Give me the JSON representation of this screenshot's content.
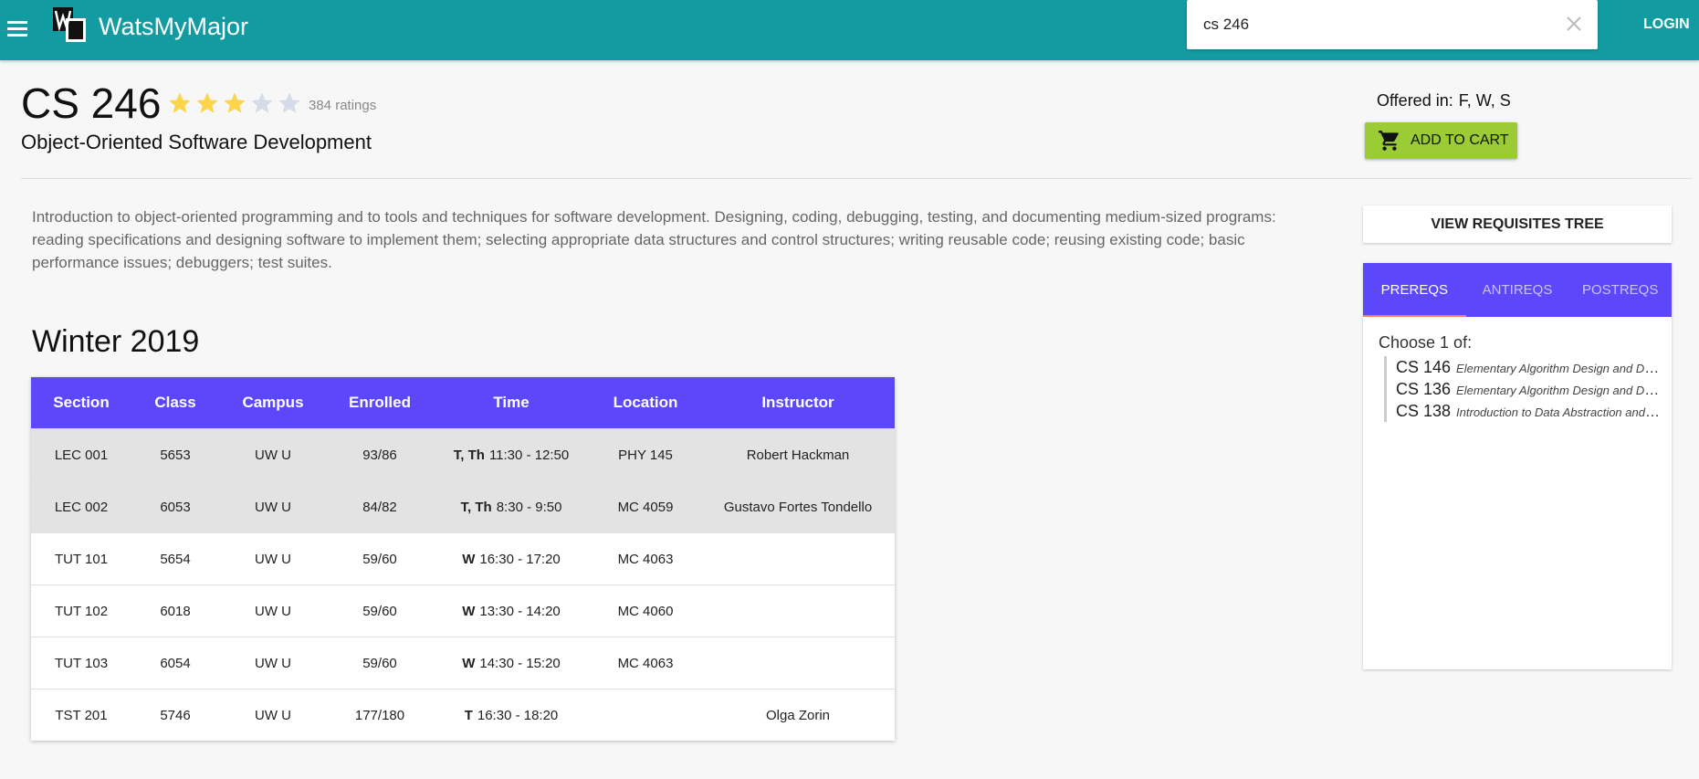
{
  "topbar": {
    "brand": "WatsMyMajor",
    "search_value": "cs 246",
    "login_label": "LOGIN",
    "color": "#129ca2"
  },
  "course": {
    "code": "CS 246",
    "title": "Object-Oriented Software Development",
    "rating": 3,
    "max_rating": 5,
    "ratings_text": "384 ratings",
    "offered_label": "Offered in:",
    "offered_value": "F, W, S",
    "cart_label": "ADD TO CART",
    "description": "Introduction to object-oriented programming and to tools and techniques for software development. Designing, coding, debugging, testing, and documenting medium-sized programs: reading specifications and designing software to implement them; selecting appropriate data structures and control structures; writing reusable code; reusing existing code; basic performance issues; debuggers; test suites."
  },
  "schedule": {
    "term": "Winter 2019",
    "headers": [
      "Section",
      "Class",
      "Campus",
      "Enrolled",
      "Time",
      "Location",
      "Instructor"
    ],
    "rows": [
      {
        "section": "LEC 001",
        "class": "5653",
        "campus": "UW U",
        "enrolled": "93/86",
        "days": "T, Th",
        "time": "11:30 - 12:50",
        "location": "PHY 145",
        "instructor": "Robert Hackman"
      },
      {
        "section": "LEC 002",
        "class": "6053",
        "campus": "UW U",
        "enrolled": "84/82",
        "days": "T, Th",
        "time": "8:30 - 9:50",
        "location": "MC 4059",
        "instructor": "Gustavo Fortes Tondello"
      },
      {
        "section": "TUT 101",
        "class": "5654",
        "campus": "UW U",
        "enrolled": "59/60",
        "days": "W",
        "time": "16:30 - 17:20",
        "location": "MC 4063",
        "instructor": ""
      },
      {
        "section": "TUT 102",
        "class": "6018",
        "campus": "UW U",
        "enrolled": "59/60",
        "days": "W",
        "time": "13:30 - 14:20",
        "location": "MC 4060",
        "instructor": ""
      },
      {
        "section": "TUT 103",
        "class": "6054",
        "campus": "UW U",
        "enrolled": "59/60",
        "days": "W",
        "time": "14:30 - 15:20",
        "location": "MC 4063",
        "instructor": ""
      },
      {
        "section": "TST 201",
        "class": "5746",
        "campus": "UW U",
        "enrolled": "177/180",
        "days": "T",
        "time": "16:30 - 18:20",
        "location": "",
        "instructor": "Olga Zorin"
      }
    ]
  },
  "requisites": {
    "tree_button": "VIEW REQUISITES TREE",
    "tabs": [
      "PREREQS",
      "ANTIREQS",
      "POSTREQS"
    ],
    "choose_label": "Choose 1 of:",
    "items": [
      {
        "code": "CS 146",
        "name": "Elementary Algorithm Design and Data Abstraction (Advanced Level)"
      },
      {
        "code": "CS 136",
        "name": "Elementary Algorithm Design and Data Abstraction"
      },
      {
        "code": "CS 138",
        "name": "Introduction to Data Abstraction and Implementation"
      }
    ]
  },
  "colors": {
    "accent": "#5d47fb",
    "cart": "#9ccc35",
    "star_filled": "#fdd54a",
    "star_empty": "#d5dbe8",
    "tab_indicator": "#ff7d4f"
  },
  "icons": [
    "menu-icon",
    "logo-icon",
    "close-icon",
    "star-icon",
    "cart-icon"
  ]
}
